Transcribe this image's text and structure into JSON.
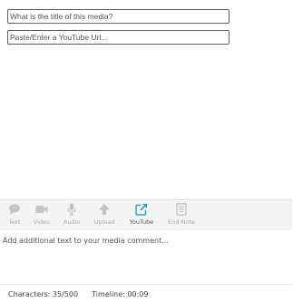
{
  "form": {
    "title_placeholder": "What is the title of this media?",
    "url_placeholder": "Paste/Enter a YouTube Url..."
  },
  "toolbar": {
    "items": [
      {
        "label": "Text",
        "icon": "speech-bubble-icon",
        "active": false
      },
      {
        "label": "Video",
        "icon": "video-camera-icon",
        "active": false
      },
      {
        "label": "Audio",
        "icon": "microphone-icon",
        "active": false
      },
      {
        "label": "Upload",
        "icon": "arrow-up-icon",
        "active": false
      },
      {
        "label": "YouTube",
        "icon": "external-link-icon",
        "active": true
      },
      {
        "label": "End Note",
        "icon": "document-icon",
        "active": false
      }
    ],
    "colors": {
      "inactive": "#c4c4c4",
      "active": "#2e9fc4"
    }
  },
  "comment": {
    "placeholder": "Add additional text to your media comment..."
  },
  "status": {
    "characters_label": "Characters:",
    "characters_value": "35/500",
    "timeline_label": "Timeline:",
    "timeline_value": "00:09"
  }
}
